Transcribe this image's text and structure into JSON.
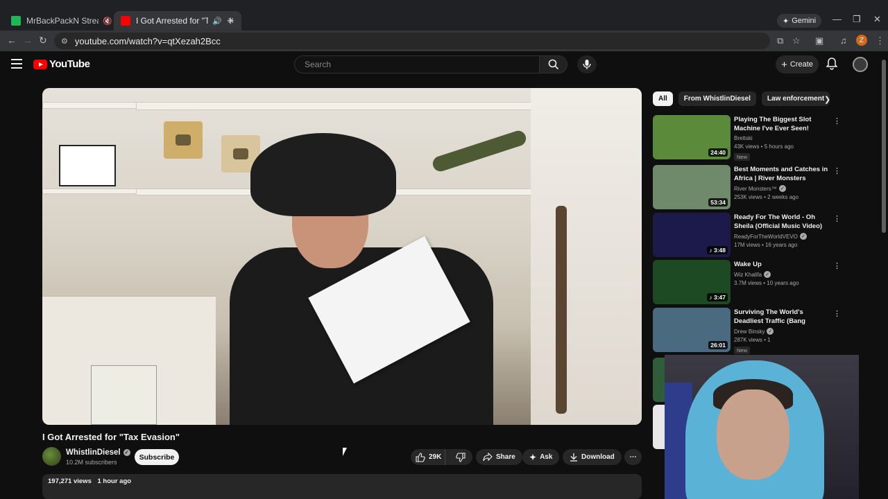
{
  "browser": {
    "tabs": [
      {
        "title": "MrBackPackN Stream - Wat",
        "favicon_color": "#1db954"
      },
      {
        "title": "I Got Arrested for \"Tax Evasi",
        "favicon_color": "#ff0000"
      }
    ],
    "gemini_label": "Gemini",
    "url": "youtube.com/watch?v=qtXezah2Bcc",
    "profile_initial": "Z"
  },
  "youtube": {
    "logo_text": "YouTube",
    "search_placeholder": "Search",
    "create_label": "Create"
  },
  "video": {
    "title": "I Got Arrested for \"Tax Evasion\"",
    "channel": "WhistlinDiesel",
    "subscribers": "10.2M subscribers",
    "subscribe_label": "Subscribe",
    "likes": "29K",
    "share_label": "Share",
    "ask_label": "Ask",
    "download_label": "Download",
    "views": "197,271 views",
    "age": "1 hour ago"
  },
  "sidebar": {
    "chips": [
      "All",
      "From WhistlinDiesel",
      "Law enforcement"
    ],
    "recommendations": [
      {
        "title": "Playing The Biggest Slot Machine I've Ever Seen!",
        "channel": "Brettski",
        "views": "43K views • 5 hours ago",
        "duration": "24:40",
        "badge": "New",
        "verified": false,
        "music": false,
        "thumb_color": "#5b8a3a"
      },
      {
        "title": "Best Moments and Catches in Africa | River Monsters",
        "channel": "River Monsters™",
        "views": "253K views • 2 weeks ago",
        "duration": "53:34",
        "badge": "",
        "verified": true,
        "music": false,
        "thumb_color": "#6f8a6a"
      },
      {
        "title": "Ready For The World - Oh Sheila (Official Music Video)",
        "channel": "ReadyForTheWorldVEVO",
        "views": "17M views • 16 years ago",
        "duration": "3:48",
        "badge": "",
        "verified": true,
        "music": true,
        "thumb_color": "#1c1a4a"
      },
      {
        "title": "Wake Up",
        "channel": "Wiz Khalifa",
        "views": "3.7M views • 10 years ago",
        "duration": "3:47",
        "badge": "",
        "verified": true,
        "music": true,
        "thumb_color": "#1d4a22"
      },
      {
        "title": "Surviving The World's Deadliest Traffic (Bang",
        "channel": "Drew Binsky",
        "views": "287K views • 1",
        "duration": "26:01",
        "badge": "New",
        "verified": true,
        "music": false,
        "thumb_color": "#4a6a80"
      }
    ]
  },
  "colors": {
    "background": "#0f0f0f",
    "brand_red": "#ff0000",
    "pill": "#272727"
  }
}
